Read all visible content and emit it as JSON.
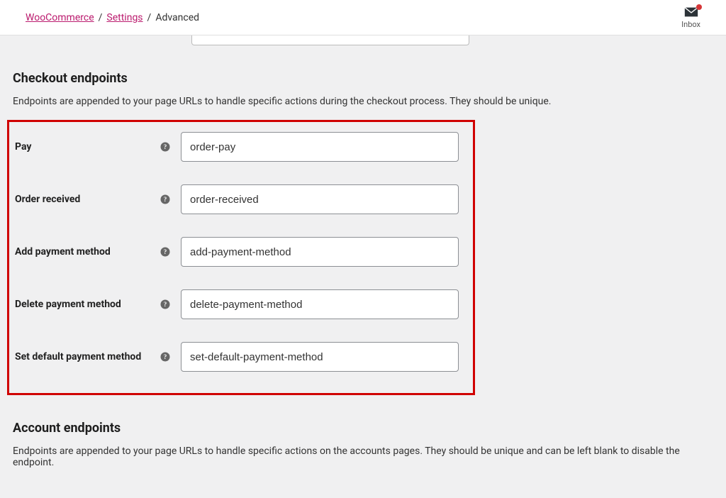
{
  "breadcrumb": {
    "root": "WooCommerce",
    "parent": "Settings",
    "current": "Advanced"
  },
  "inbox_label": "Inbox",
  "sections": {
    "checkout": {
      "title": "Checkout endpoints",
      "description": "Endpoints are appended to your page URLs to handle specific actions during the checkout process. They should be unique.",
      "fields": [
        {
          "label": "Pay",
          "value": "order-pay"
        },
        {
          "label": "Order received",
          "value": "order-received"
        },
        {
          "label": "Add payment method",
          "value": "add-payment-method"
        },
        {
          "label": "Delete payment method",
          "value": "delete-payment-method"
        },
        {
          "label": "Set default payment method",
          "value": "set-default-payment-method"
        }
      ]
    },
    "account": {
      "title": "Account endpoints",
      "description": "Endpoints are appended to your page URLs to handle specific actions on the accounts pages. They should be unique and can be left blank to disable the endpoint."
    }
  }
}
